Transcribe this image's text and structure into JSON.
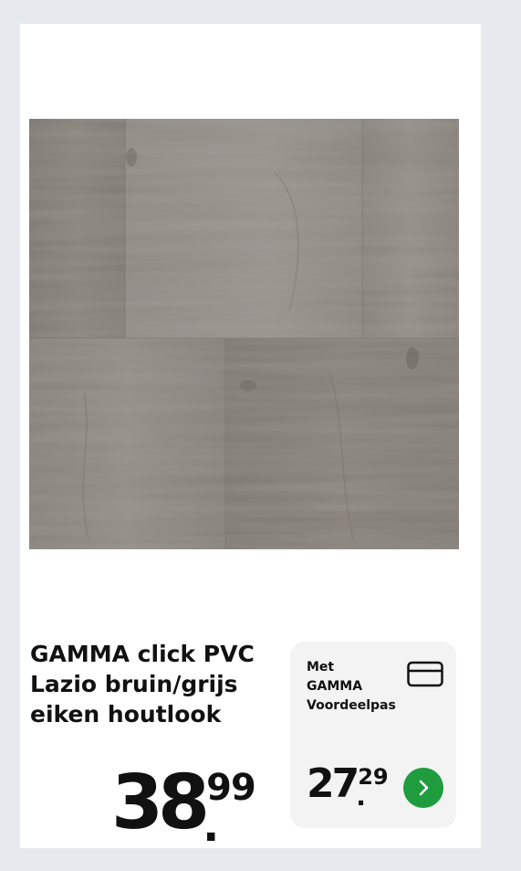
{
  "product": {
    "title_lines": [
      "GAMMA click PVC",
      "Lazio bruin/grijs",
      "eiken houtlook"
    ],
    "image_alt": "Grijze eiken houtlook PVC vloerplank"
  },
  "regular_price": {
    "whole": "38",
    "decimals": "99",
    "separator": "."
  },
  "member_offer": {
    "label_lines": [
      "Met",
      "GAMMA",
      "Voordeelpas"
    ],
    "card_icon": "loyalty-card-icon",
    "price": {
      "whole": "27",
      "decimals": "29",
      "separator": "."
    },
    "action_icon": "chevron-right-icon"
  },
  "colors": {
    "page_background": "#e6e9ee",
    "card_background": "#ffffff",
    "member_box_background": "#f3f3f3",
    "accent_green": "#1e9c3e",
    "text": "#111111",
    "wood_base": "#8a8580"
  }
}
